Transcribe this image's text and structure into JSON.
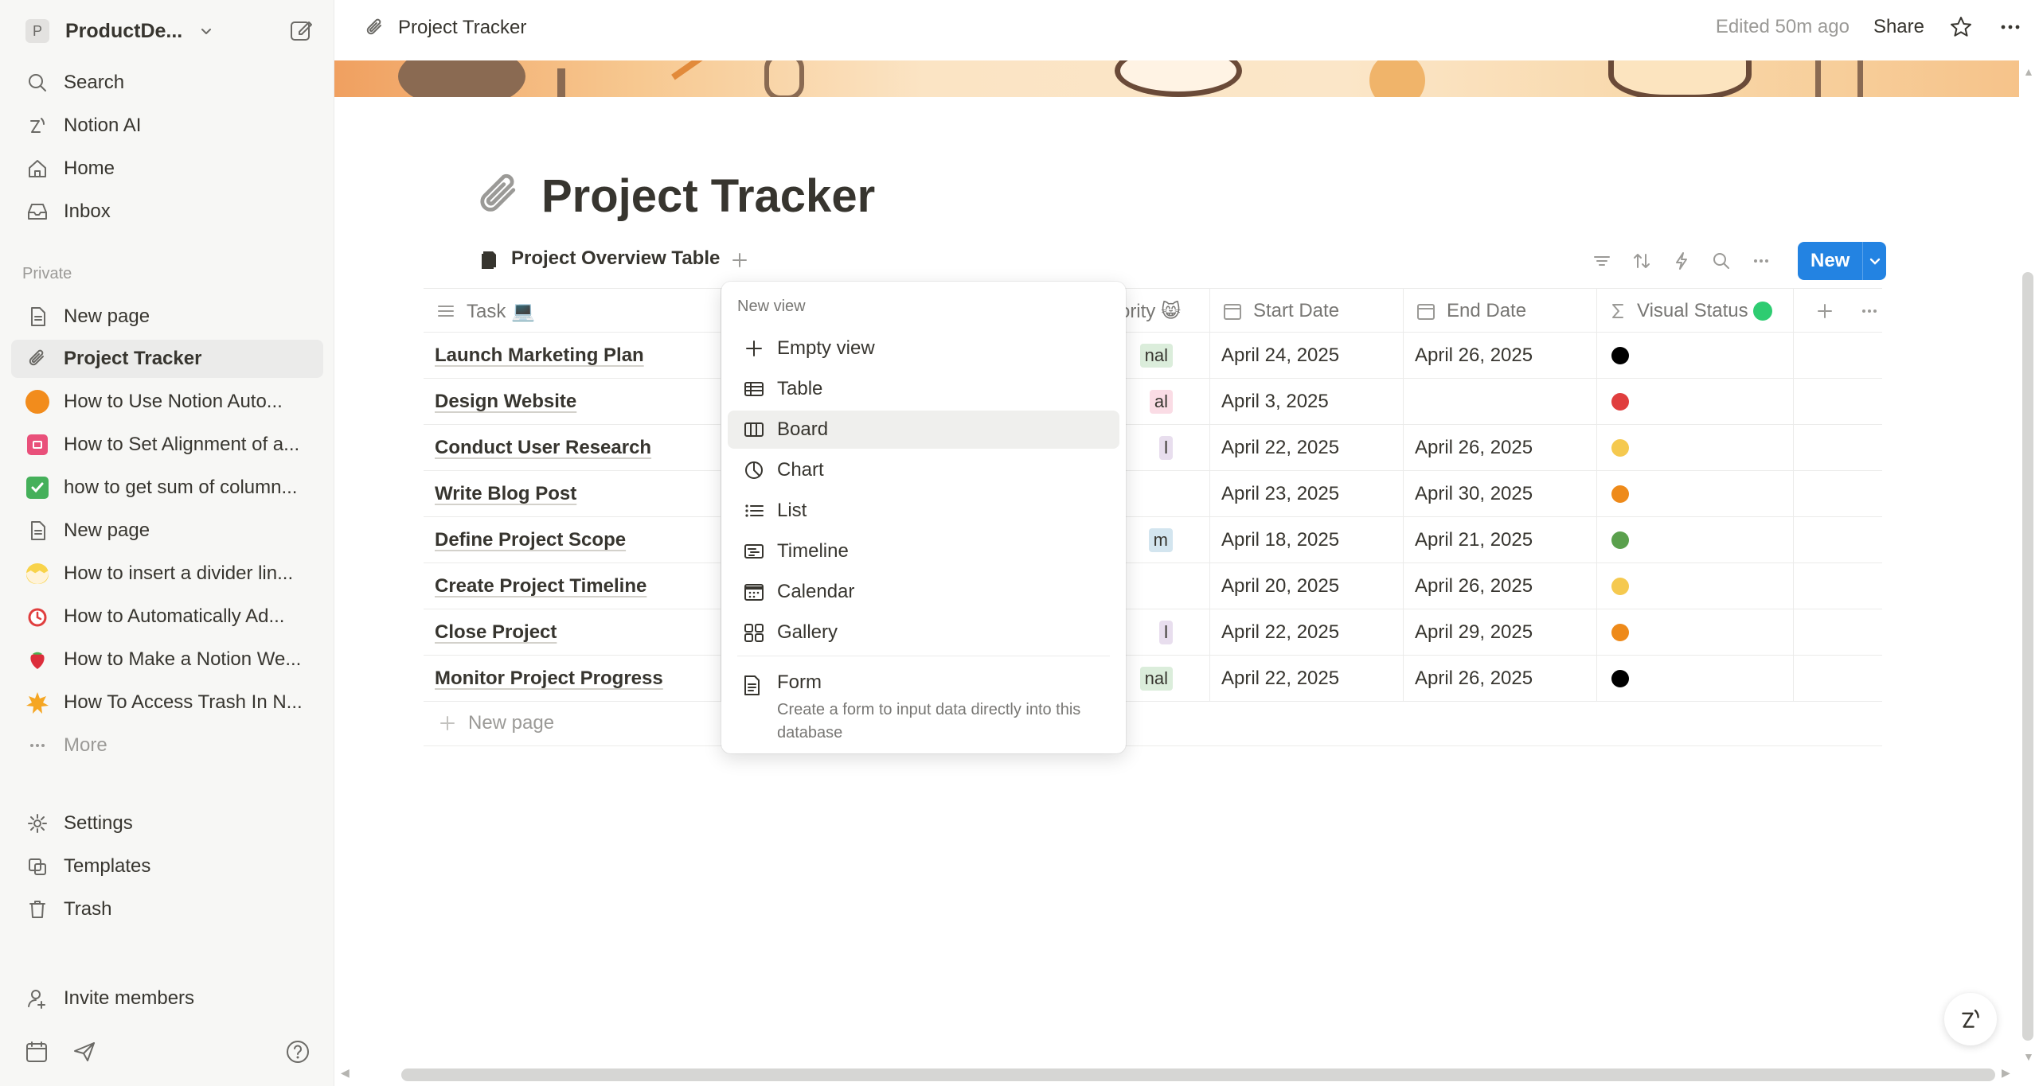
{
  "workspace": {
    "badge": "P",
    "name": "ProductDe..."
  },
  "sidebar": {
    "top_items": [
      {
        "label": "Search",
        "icon": "search-icon"
      },
      {
        "label": "Notion AI",
        "icon": "notion-ai-icon"
      },
      {
        "label": "Home",
        "icon": "home-icon"
      },
      {
        "label": "Inbox",
        "icon": "inbox-icon"
      }
    ],
    "section_label": "Private",
    "pages": [
      {
        "label": "New page",
        "icon": "page-icon"
      },
      {
        "label": "Project Tracker",
        "icon": "paperclip-icon",
        "active": true
      },
      {
        "label": "How to Use Notion Auto...",
        "icon": "orange-circle-icon"
      },
      {
        "label": "How to Set Alignment of a...",
        "icon": "pink-box-icon"
      },
      {
        "label": "how to get sum of column...",
        "icon": "green-check-icon"
      },
      {
        "label": "New page",
        "icon": "page-icon"
      },
      {
        "label": "How to insert a divider lin...",
        "icon": "chick-icon"
      },
      {
        "label": "How to Automatically Ad...",
        "icon": "alarm-clock-icon"
      },
      {
        "label": "How to Make a Notion We...",
        "icon": "strawberry-icon"
      },
      {
        "label": "How To Access Trash In N...",
        "icon": "star-burst-icon"
      },
      {
        "label": "More",
        "icon": "more-icon"
      }
    ],
    "bottom_items": [
      {
        "label": "Settings",
        "icon": "gear-icon"
      },
      {
        "label": "Templates",
        "icon": "templates-icon"
      },
      {
        "label": "Trash",
        "icon": "trash-icon"
      }
    ],
    "invite": {
      "label": "Invite members",
      "icon": "invite-icon"
    }
  },
  "topbar": {
    "breadcrumb": "Project Tracker",
    "edited": "Edited 50m ago",
    "share": "Share"
  },
  "page": {
    "title": "Project Tracker",
    "view_tab": "Project Overview Table",
    "new_button": "New"
  },
  "table": {
    "columns": [
      {
        "label": "Task 💻",
        "icon": "lines-icon"
      },
      {
        "label": "ority 😸",
        "icon": ""
      },
      {
        "label": "Start Date",
        "icon": "calendar-icon"
      },
      {
        "label": "End Date",
        "icon": "calendar-icon"
      },
      {
        "label": "Visual Status",
        "icon": "sigma-icon"
      }
    ],
    "rows": [
      {
        "task": "Launch Marketing Plan",
        "priority": "nal",
        "priority_color": "#dbeddb",
        "start": "April 24, 2025",
        "end": "April 26, 2025",
        "status_color": "#000000"
      },
      {
        "task": "Design Website",
        "priority": "al",
        "priority_color": "#fadce5",
        "start": "April 3, 2025",
        "end": "",
        "status_color": "#e03e3e"
      },
      {
        "task": "Conduct User Research",
        "priority": "l",
        "priority_color": "#e8deee",
        "start": "April 22, 2025",
        "end": "April 26, 2025",
        "status_color": "#f5c94f"
      },
      {
        "task": "Write Blog Post",
        "priority": "",
        "priority_color": "",
        "start": "April 23, 2025",
        "end": "April 30, 2025",
        "status_color": "#ee8a1a"
      },
      {
        "task": "Define Project Scope",
        "priority": "m",
        "priority_color": "#d3e5ef",
        "start": "April 18, 2025",
        "end": "April 21, 2025",
        "status_color": "#5aa04d"
      },
      {
        "task": "Create Project Timeline",
        "priority": "",
        "priority_color": "",
        "start": "April 20, 2025",
        "end": "April 26, 2025",
        "status_color": "#f5c94f"
      },
      {
        "task": "Close Project",
        "priority": "l",
        "priority_color": "#e8deee",
        "start": "April 22, 2025",
        "end": "April 29, 2025",
        "status_color": "#ee8a1a"
      },
      {
        "task": "Monitor Project Progress",
        "priority": "nal",
        "priority_color": "#dbeddb",
        "start": "April 22, 2025",
        "end": "April 26, 2025",
        "status_color": "#000000"
      }
    ],
    "new_row": "New page"
  },
  "dropdown": {
    "header": "New view",
    "items": [
      {
        "label": "Empty view",
        "icon": "plus-icon"
      },
      {
        "label": "Table",
        "icon": "table-icon"
      },
      {
        "label": "Board",
        "icon": "board-icon"
      },
      {
        "label": "Chart",
        "icon": "chart-icon"
      },
      {
        "label": "List",
        "icon": "list-icon"
      },
      {
        "label": "Timeline",
        "icon": "timeline-icon"
      },
      {
        "label": "Calendar",
        "icon": "calendar-icon"
      },
      {
        "label": "Gallery",
        "icon": "gallery-icon"
      }
    ],
    "form": {
      "label": "Form",
      "description": "Create a form to input data directly into this database"
    }
  },
  "colors": {
    "accent": "#2383e2",
    "sidebar_bg": "#f7f7f5",
    "status_header_dot": "#2ecc71"
  }
}
